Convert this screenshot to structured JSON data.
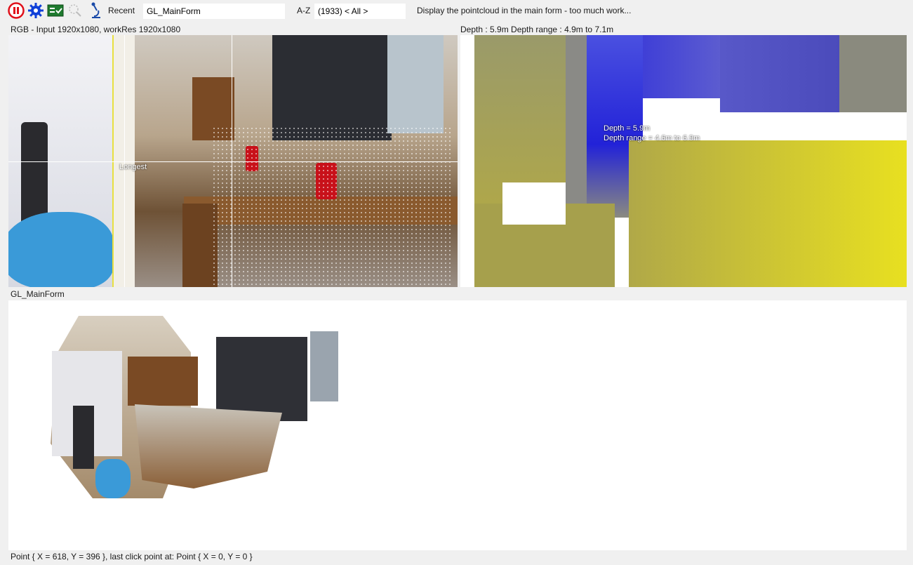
{
  "toolbar": {
    "pause_icon": "pause-icon",
    "settings_icon": "gear-icon",
    "checklist_icon": "checklist-icon",
    "magnify_icon": "magnifier-icon",
    "microscope_icon": "microscope-icon",
    "recent_label": "Recent",
    "form_combo_value": "GL_MainForm",
    "sort_label": "A-Z",
    "filter_combo_value": "(1933) < All >",
    "description": "Display the pointcloud in the main form - too much work..."
  },
  "rgb_panel": {
    "label": "RGB - Input 1920x1080, workRes 1920x1080",
    "overlay_label": "Longest"
  },
  "depth_panel": {
    "label": "Depth : 5.9m Depth range : 4.9m to 7.1m",
    "overlay_depth": "Depth = 5.9m",
    "overlay_range": "Depth range = 4.6m to 6.9m"
  },
  "gl_panel": {
    "label": "GL_MainForm"
  },
  "status": {
    "text": "Point { X = 618, Y = 396 }, last click point at: Point { X = 0, Y = 0 }"
  },
  "colors": {
    "pause_red": "#e0101a",
    "gear_blue": "#1040d8",
    "checklist_green": "#1e7a2e",
    "depth_blue": "#2222d8",
    "depth_yellow": "#e8e020"
  }
}
